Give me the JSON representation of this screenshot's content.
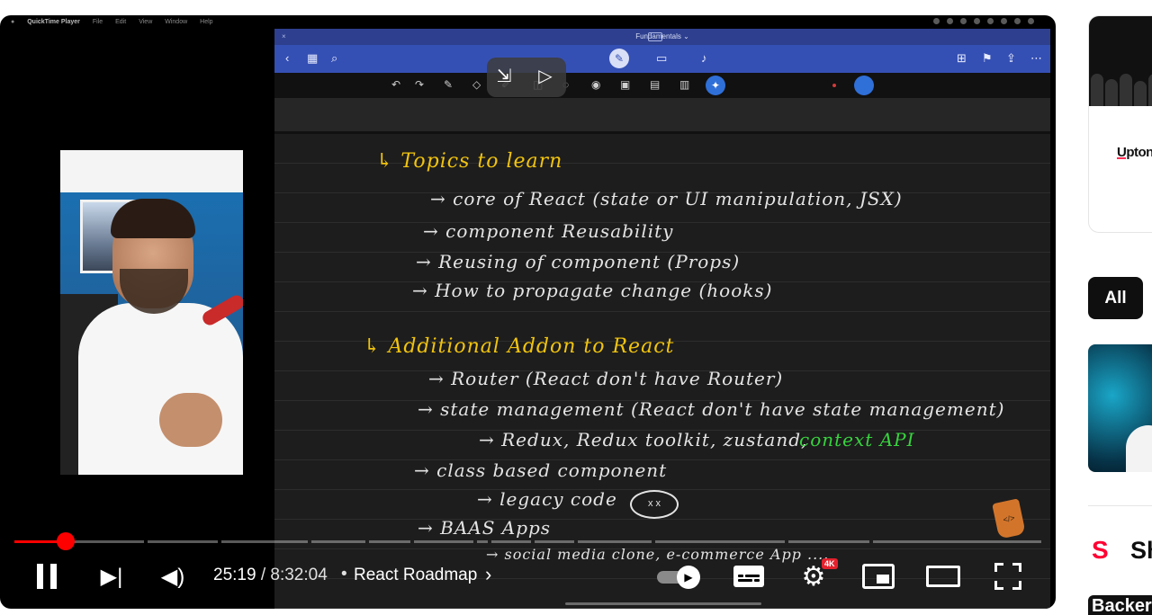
{
  "mac_menubar": {
    "items": [
      "QuickTime Player",
      "File",
      "Edit",
      "View",
      "Window",
      "Help"
    ]
  },
  "notes_app": {
    "document_title": "Fundamentals ⌄",
    "close_label": "×",
    "handwriting": [
      {
        "text": "↳ Topics to learn",
        "style": "head"
      },
      {
        "text": "→ core of React (state or UI manipulation, JSX)",
        "style": "normal"
      },
      {
        "text": "→ component Reusability",
        "style": "normal"
      },
      {
        "text": "→ Reusing of component (Props)",
        "style": "normal"
      },
      {
        "text": "→ How to propagate change (hooks)",
        "style": "normal"
      },
      {
        "text": "↳ Additional Addon to React",
        "style": "head"
      },
      {
        "text": "→ Router (React don't have Router)",
        "style": "normal"
      },
      {
        "text": "→ state management (React don't have state management)",
        "style": "normal"
      },
      {
        "text": "→ Redux, Redux toolkit, zustand,",
        "style": "normal"
      },
      {
        "text": "context API",
        "style": "green"
      },
      {
        "text": "→ class based component",
        "style": "normal"
      },
      {
        "text": "→ legacy code",
        "style": "normal"
      },
      {
        "text": "→ BAAS Apps",
        "style": "normal"
      },
      {
        "text": "→ social media clone, e-commerce App ....",
        "style": "normal"
      }
    ],
    "face_doodle": "x x",
    "cup_doodle": "</>"
  },
  "player": {
    "current_time": "25:19",
    "duration": " / 8:32:04",
    "separator": "•",
    "chapter_title": "React Roadmap",
    "quality_badge": "4K",
    "progress": 0.0497,
    "accent_color": "#ff0000"
  },
  "sidebar": {
    "ad_brand": "Upton",
    "chip_all": "All",
    "shorts_label": "Sh",
    "bottom_title": "Backer"
  }
}
